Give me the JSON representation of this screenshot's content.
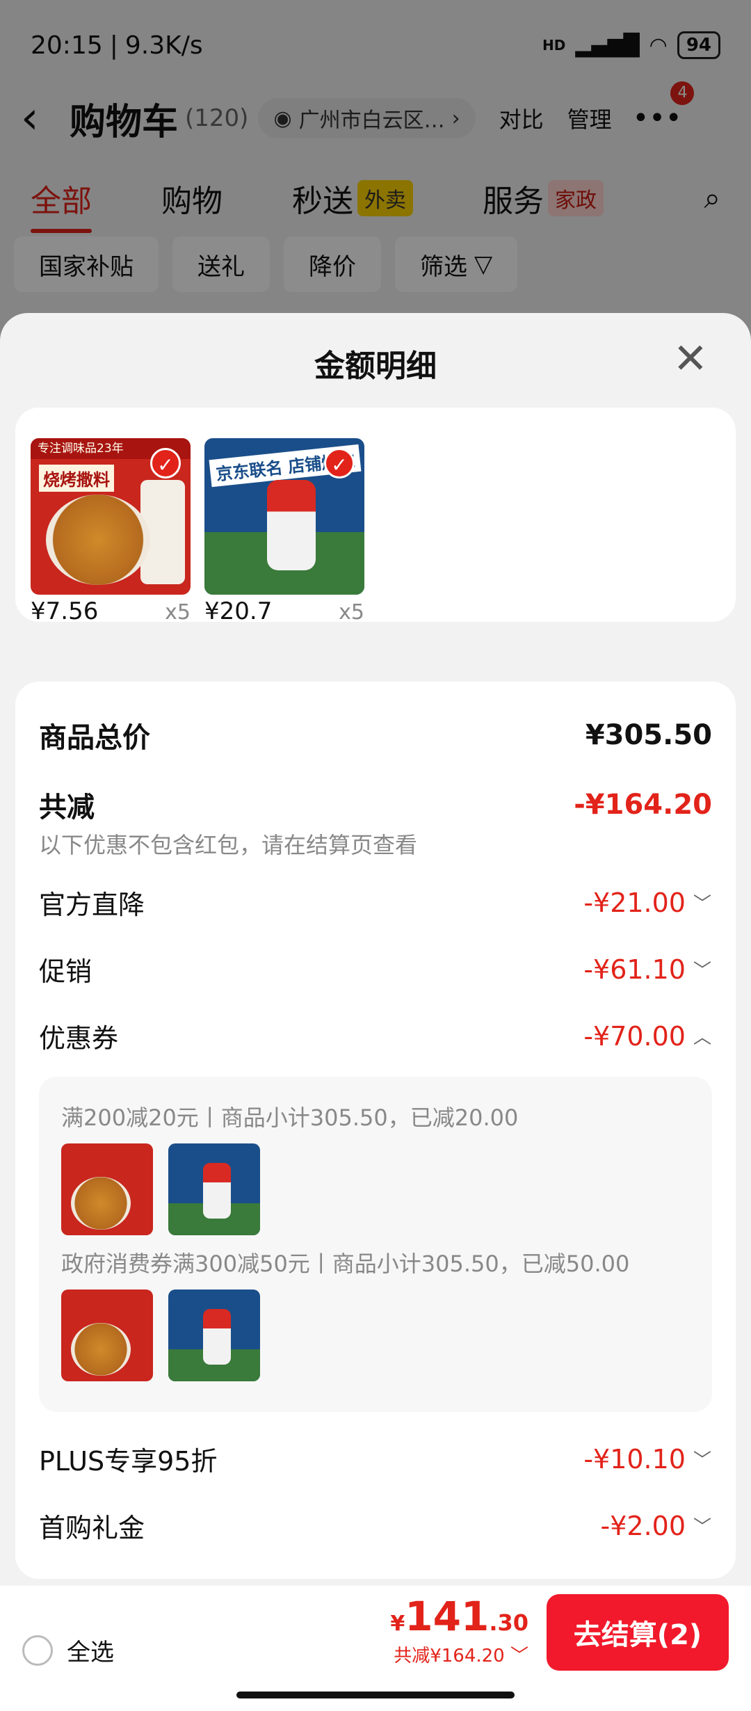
{
  "status_bar": {
    "time": "20:15",
    "speed": "9.3K/s",
    "hd": "HD",
    "battery": "94"
  },
  "header": {
    "back_icon": "‹",
    "title": "购物车",
    "count": "(120)",
    "location": "广州市白云区…",
    "compare": "对比",
    "manage": "管理",
    "more_badge": "4"
  },
  "tabs": [
    {
      "label": "全部"
    },
    {
      "label": "购物"
    },
    {
      "label": "秒送",
      "badge": "外卖"
    },
    {
      "label": "服务",
      "badge": "家政"
    }
  ],
  "filters": [
    "国家补贴",
    "送礼",
    "降价",
    "筛选"
  ],
  "sheet": {
    "title": "金额明细",
    "close_icon": "✕",
    "products": [
      {
        "price": "¥7.56",
        "qty": "x5",
        "image_banner": "专注调味品23年",
        "image_name": "烧烤撒料"
      },
      {
        "price": "¥20.7",
        "qty": "x5",
        "image_banner": "京东联名 店铺爆款",
        "image_name": ""
      }
    ],
    "total_label": "商品总价",
    "total_value": "¥305.50",
    "reduce_label": "共减",
    "reduce_value": "-¥164.20",
    "reduce_note": "以下优惠不包含红包，请在结算页查看",
    "discounts": [
      {
        "label": "官方直降",
        "value": "-¥21.00",
        "icon": "chevron-down"
      },
      {
        "label": "促销",
        "value": "-¥61.10",
        "icon": "chevron-down"
      },
      {
        "label": "优惠券",
        "value": "-¥70.00",
        "icon": "chevron-up"
      }
    ],
    "coupons": [
      {
        "text": "满200减20元丨商品小计305.50，已减20.00"
      },
      {
        "text": "政府消费券满300减50元丨商品小计305.50，已减50.00"
      }
    ],
    "extra_discounts": [
      {
        "label": "PLUS专享95折",
        "value": "-¥10.10",
        "icon": "chevron-down"
      },
      {
        "label": "首购礼金",
        "value": "-¥2.00",
        "icon": "chevron-down"
      }
    ]
  },
  "bottom": {
    "select_all": "全选",
    "currency": "¥",
    "total_int": "141",
    "total_dec": ".30",
    "reduce_summary": "共减¥164.20",
    "checkout": "去结算(2)"
  }
}
